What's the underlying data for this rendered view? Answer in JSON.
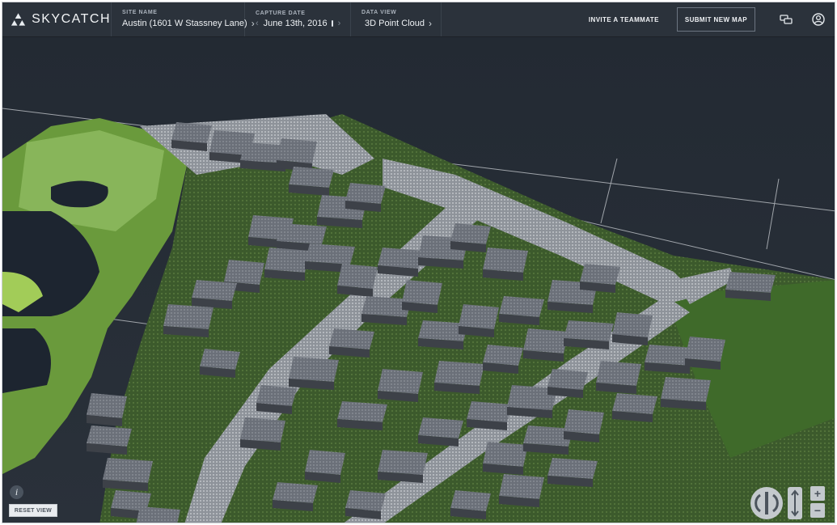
{
  "app": {
    "brand": "SKYCATCH",
    "logo_icon": "skycatch-logo-icon",
    "colors": {
      "topbar": "#2b323b",
      "background": "#232a33",
      "accent_text": "#f0f2f5"
    }
  },
  "header": {
    "site": {
      "label": "SITE NAME",
      "value": "Austin (1601 W Stassney Lane)",
      "icon": "chevron-right-icon"
    },
    "capture": {
      "label": "CAPTURE DATE",
      "value": "June 13th, 2016",
      "prev_icon": "chevron-left-icon",
      "next_icon": "chevron-right-icon",
      "calendar_icon": "calendar-icon"
    },
    "view": {
      "label": "DATA VIEW",
      "value": "3D Point Cloud",
      "icon": "point-cloud-icon"
    },
    "invite_label": "INVITE A TEAMMATE",
    "submit_label": "SUBMIT NEW MAP",
    "chat_icon": "chat-icon",
    "user_icon": "user-account-icon"
  },
  "viewer": {
    "content": "3d-point-cloud-view",
    "info_label": "i",
    "reset_label": "RESET VIEW",
    "controls": {
      "rotate_icon": "rotate-icon",
      "tilt_icon": "tilt-icon",
      "zoom_in_label": "+",
      "zoom_out_label": "−"
    }
  }
}
